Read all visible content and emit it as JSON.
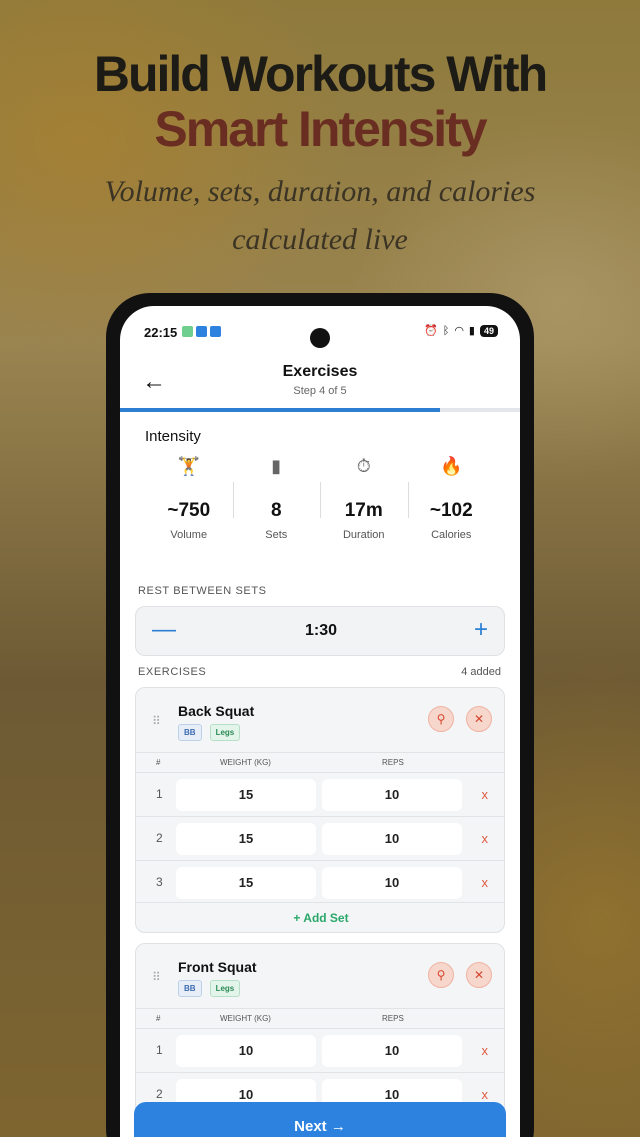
{
  "hero": {
    "line1": "Build Workouts With",
    "line2": "Smart Intensity",
    "tagline": "Volume, sets, duration, and calories calculated live"
  },
  "status_bar": {
    "time": "22:15",
    "battery": "49"
  },
  "app_bar": {
    "title": "Exercises",
    "subtitle": "Step 4 of 5",
    "progress_fraction": 0.8
  },
  "intensity": {
    "heading": "Intensity",
    "stats": [
      {
        "icon": "dumbbell-icon",
        "value": "~750",
        "label": "Volume"
      },
      {
        "icon": "bar-chart-icon",
        "value": "8",
        "label": "Sets"
      },
      {
        "icon": "stopwatch-icon",
        "value": "17m",
        "label": "Duration"
      },
      {
        "icon": "flame-icon",
        "value": "~102",
        "label": "Calories"
      }
    ]
  },
  "rest": {
    "heading": "REST BETWEEN SETS",
    "value": "1:30"
  },
  "exercises": {
    "heading": "EXERCISES",
    "count": "4 added",
    "col_num": "#",
    "col_weight": "WEIGHT (KG)",
    "col_reps": "REPS",
    "remove_symbol": "x",
    "add_set_label": "+ Add Set",
    "items": [
      {
        "name": "Back Squat",
        "tags": [
          "BB",
          "Legs"
        ],
        "sets": [
          {
            "n": "1",
            "weight": "15",
            "reps": "10"
          },
          {
            "n": "2",
            "weight": "15",
            "reps": "10"
          },
          {
            "n": "3",
            "weight": "15",
            "reps": "10"
          }
        ]
      },
      {
        "name": "Front Squat",
        "tags": [
          "BB",
          "Legs"
        ],
        "sets": [
          {
            "n": "1",
            "weight": "10",
            "reps": "10"
          },
          {
            "n": "2",
            "weight": "10",
            "reps": "10"
          }
        ]
      }
    ]
  },
  "next_label": "Next",
  "colors": {
    "accent": "#2d82e0",
    "danger": "#d6472b",
    "success": "#2aa86a",
    "hero_accent": "#6a2d22"
  }
}
